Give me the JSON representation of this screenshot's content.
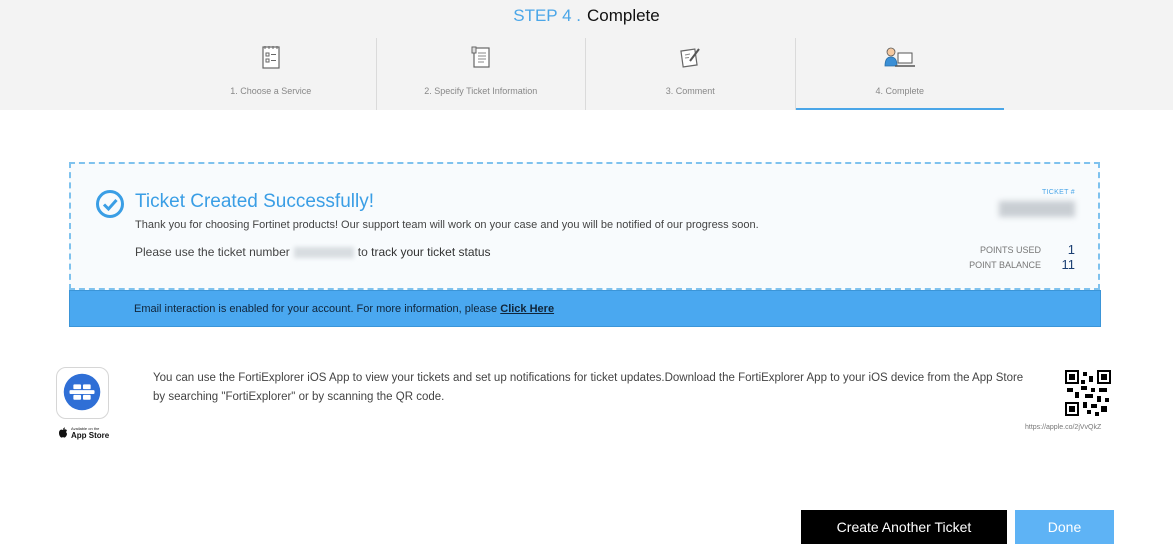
{
  "header": {
    "step_prefix": "STEP 4 .",
    "step_name": "Complete",
    "steps": [
      {
        "label": "1. Choose a Service",
        "icon": "checklist-icon",
        "active": false
      },
      {
        "label": "2. Specify Ticket Information",
        "icon": "document-icon",
        "active": false
      },
      {
        "label": "3. Comment",
        "icon": "edit-note-icon",
        "active": false
      },
      {
        "label": "4. Complete",
        "icon": "support-agent-icon",
        "active": true
      }
    ]
  },
  "success": {
    "title": "Ticket Created Successfully!",
    "message": "Thank you for choosing Fortinet products! Our support team will work on your case and you will be notified of our progress soon.",
    "track_prefix": "Please use the ticket number",
    "track_suffix_joiner": "to",
    "track_link": "track your ticket status",
    "ticket_label": "TICKET #",
    "points_used_label": "POINTS USED",
    "points_used_value": "1",
    "point_balance_label": "POINT BALANCE",
    "point_balance_value": "11"
  },
  "email_bar": {
    "text": "Email interaction is enabled for your account. For more information, please",
    "link": "Click Here"
  },
  "app_promo": {
    "badge_small": "Available on the",
    "badge_big": "App Store",
    "text": "You can use the FortiExplorer iOS App to view your tickets and set up notifications for ticket updates.Download the FortiExplorer App to your iOS device from the App Store by searching \"FortiExplorer\" or by scanning the QR code.",
    "qr_url": "https://apple.co/2jVvQkZ"
  },
  "buttons": {
    "create_another": "Create Another Ticket",
    "done": "Done"
  },
  "colors": {
    "accent": "#4aa6e8",
    "email_bar": "#4aa8f0",
    "done_button": "#5eb3f5",
    "header_bg": "#f3f3f3"
  }
}
